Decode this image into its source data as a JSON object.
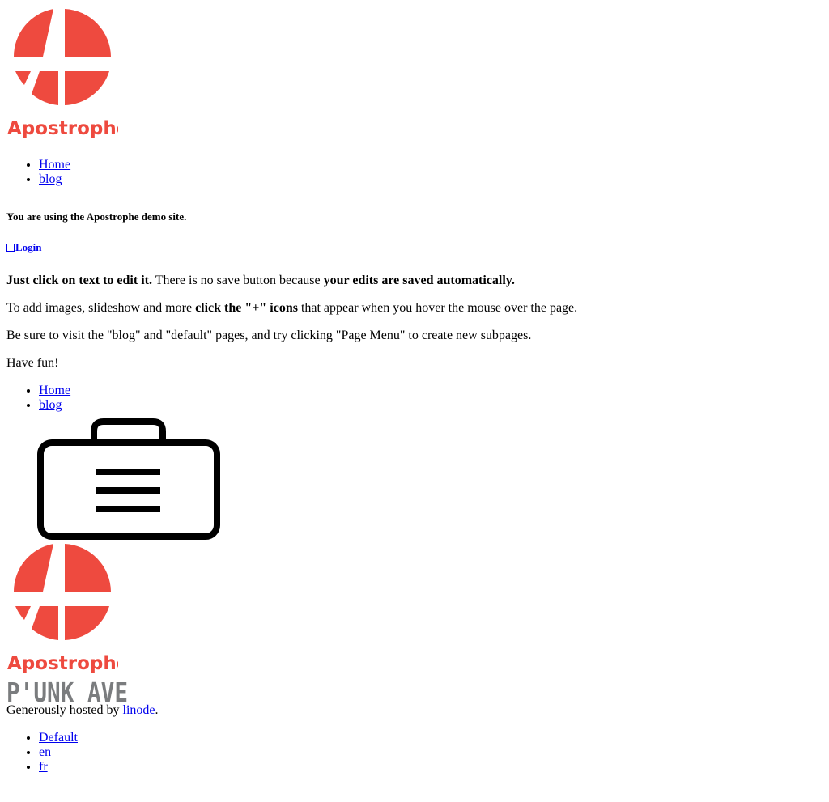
{
  "brand": {
    "logo_wordmark": "Apostrophe",
    "logo_color": "#ee4a3f"
  },
  "nav_top": [
    {
      "label": "Home"
    },
    {
      "label": "blog"
    }
  ],
  "demo_note": "You are using the Apostrophe demo site.",
  "login": {
    "icon": "login-box-icon",
    "label": "Login"
  },
  "intro": {
    "p1_bold1": "Just click on text to edit it.",
    "p1_text": " There is no save button because ",
    "p1_bold2": "your edits are saved automatically.",
    "p2_text1": "To add images, slideshow and more ",
    "p2_bold": "click the \"+\" icons",
    "p2_text2": " that appear when you hover the mouse over the page.",
    "p3": "Be sure to visit the \"blog\" and \"default\" pages, and try clicking \"Page Menu\" to create new subpages.",
    "p4": "Have fun!"
  },
  "nav_bottom": [
    {
      "label": "Home"
    },
    {
      "label": "blog"
    }
  ],
  "toolbox": {
    "icon": "toolbox-icon"
  },
  "footer": {
    "logo_wordmark": "Apostrophe",
    "punk_wordmark": "P'UNK AVE",
    "punk_color": "#7a7c7e",
    "hosted_prefix": "Generously hosted by ",
    "hosted_link": "linode",
    "hosted_suffix": "."
  },
  "locales": [
    {
      "label": "Default"
    },
    {
      "label": "en"
    },
    {
      "label": "fr"
    }
  ]
}
